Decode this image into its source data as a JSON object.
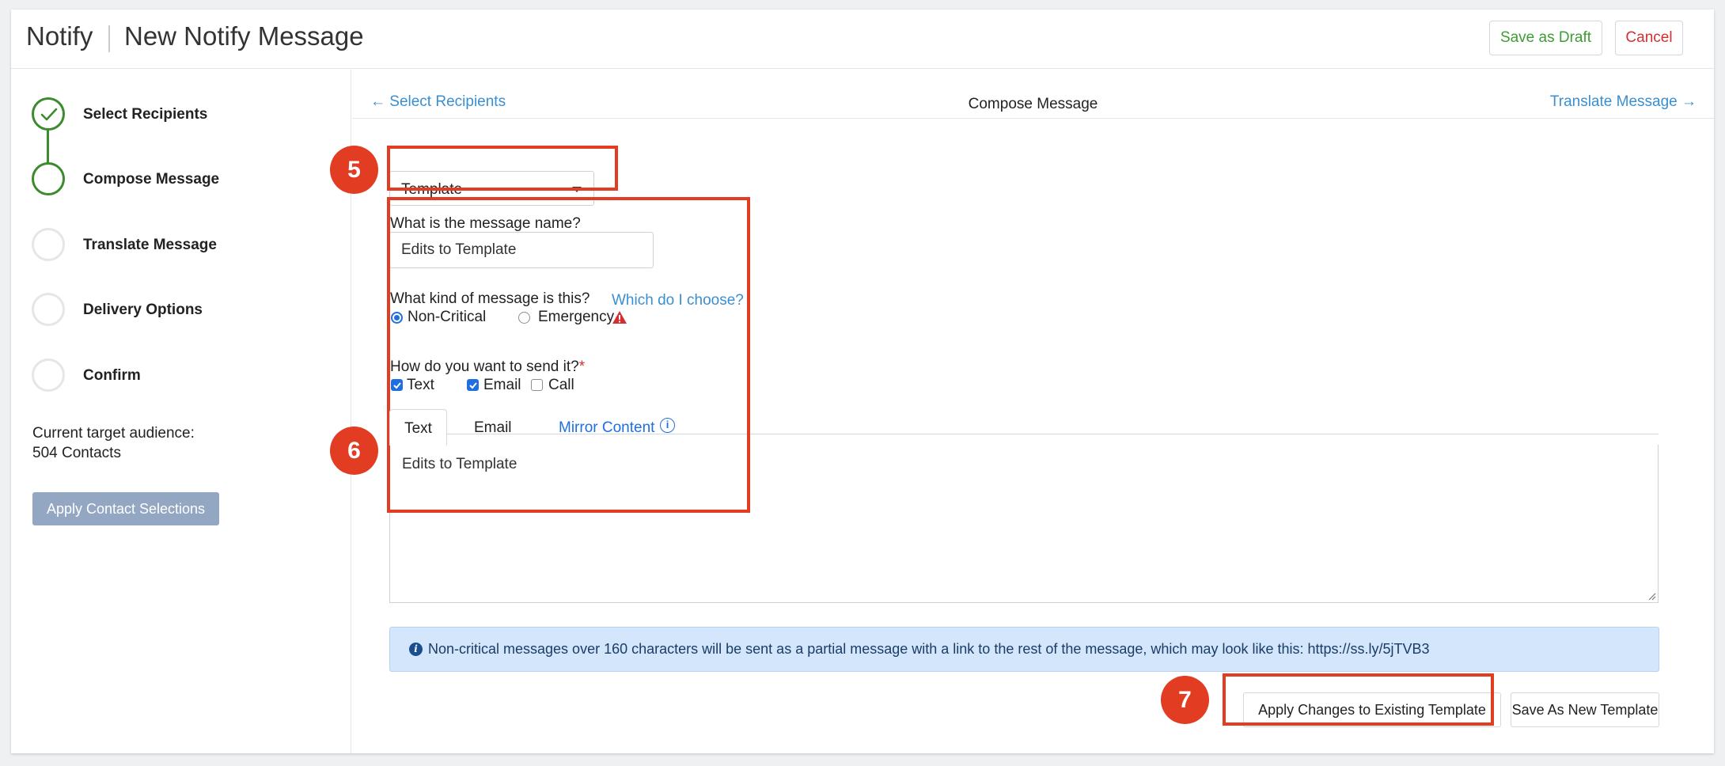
{
  "header": {
    "app_name": "Notify",
    "page_title": "New Notify Message",
    "save_draft_label": "Save as Draft",
    "cancel_label": "Cancel"
  },
  "sidebar": {
    "steps": [
      {
        "label": "Select Recipients",
        "state": "done"
      },
      {
        "label": "Compose Message",
        "state": "active"
      },
      {
        "label": "Translate Message",
        "state": "pending"
      },
      {
        "label": "Delivery Options",
        "state": "pending"
      },
      {
        "label": "Confirm",
        "state": "pending"
      }
    ],
    "audience_label": "Current target audience:",
    "audience_count": "504 Contacts",
    "apply_button": "Apply Contact Selections"
  },
  "subnav": {
    "back_label": "← Select Recipients",
    "current_label": "Compose Message",
    "next_label": "Translate Message →"
  },
  "form": {
    "type_select": "Template",
    "name_question": "What is the message name?",
    "name_value": "Edits to Template",
    "kind_question": "What kind of message is this?",
    "kind_help": "Which do I choose?",
    "kind_options": [
      {
        "label": "Non-Critical",
        "checked": true
      },
      {
        "label": "Emergency",
        "checked": false
      }
    ],
    "send_question": "How do you want to send it?",
    "required_marker": "*",
    "send_options": [
      {
        "label": "Text",
        "checked": true
      },
      {
        "label": "Email",
        "checked": true
      },
      {
        "label": "Call",
        "checked": false
      }
    ],
    "tabs": [
      {
        "label": "Text",
        "active": true
      },
      {
        "label": "Email",
        "active": false
      }
    ],
    "mirror_label": "Mirror Content",
    "info_glyph": "i",
    "message_body": "Edits to Template"
  },
  "alert": {
    "icon": "i",
    "text": "Non-critical messages over 160 characters will be sent as a partial message with a link to the rest of the message, which may look like this: https://ss.ly/5jTVB3"
  },
  "actions": {
    "apply_changes": "Apply Changes to Existing Template",
    "save_new": "Save As New Template"
  },
  "annotations": {
    "badge_5": "5",
    "badge_6": "6",
    "badge_7": "7",
    "color": "#e23c22"
  },
  "colors": {
    "accent_green": "#3d8b2f",
    "link_blue": "#3a8fd0",
    "primary_blue": "#1f6fe0",
    "danger_red": "#d32f2f",
    "alert_bg": "#d4e6fc"
  }
}
